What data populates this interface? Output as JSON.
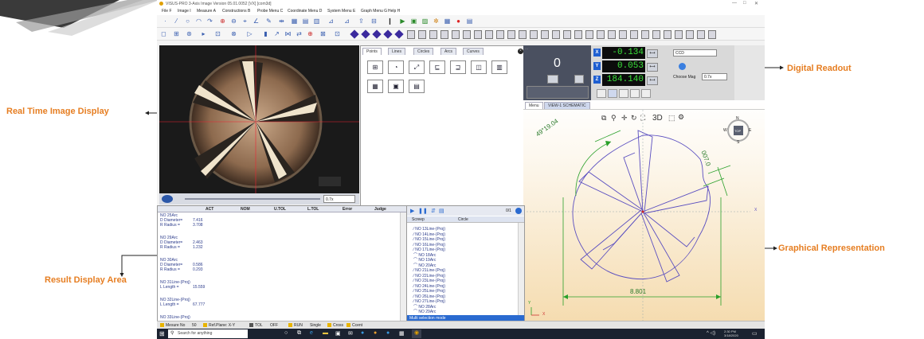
{
  "title_bar": {
    "text": "VISUS-PRO 3-Axis Image   Version 05.01.0052 [VX] [com3d]",
    "min": "—",
    "max": "□",
    "close": "✕"
  },
  "menu": [
    "File F",
    "Image I",
    "Measure A",
    "Constructions B",
    "Probe Menu C",
    "Coordinate Menu D",
    "System Menu E",
    "Graph Menu G",
    "Help H"
  ],
  "callouts": {
    "real_time": "Real Time Image Display",
    "digital_readout": "Digital Readout",
    "result_area": "Result Display Area",
    "graphical": "Graphical Representation"
  },
  "camera": {
    "zoom_select": "0.7x"
  },
  "tools_tabs": [
    "Points",
    "Lines",
    "Circles",
    "Arcs",
    "Curves"
  ],
  "readout": {
    "main_value": "0",
    "x_label": "X",
    "x_value": "-0.134",
    "y_label": "Y",
    "y_value": "0.053",
    "z_label": "Z",
    "z_value": "184.140",
    "camera_select": "CCD",
    "choose_mag_label": "Choose Mag",
    "mag_value": "0.7x"
  },
  "graph": {
    "tabs": [
      "Menu",
      "VIEW-1 SCHEMATIC"
    ],
    "toolbar_3d": "3D",
    "angle_label": "49°19.04",
    "tilt_label": "007.0",
    "width_label": "8.801",
    "compass_n": "N",
    "compass_s": "S",
    "compass_e": "E",
    "compass_w": "W",
    "compass_center": "TOP",
    "axis_x": "X",
    "axis_y": "Y"
  },
  "results": {
    "columns": [
      "ACT",
      "NOM",
      "U.TOL",
      "L.TOL",
      "Error",
      "Judge"
    ],
    "rows": [
      {
        "name": "NO  25Arc",
        "lines": [
          [
            "D  Diameter=",
            "7.416"
          ],
          [
            "R Radius =",
            "3.708"
          ]
        ]
      },
      {
        "name": "NO  29Arc",
        "lines": [
          [
            "D  Diameter=",
            "2.463"
          ],
          [
            "R Radius =",
            "1.232"
          ]
        ]
      },
      {
        "name": "NO  30Arc",
        "lines": [
          [
            "D  Diameter=",
            "0.586"
          ],
          [
            "R Radius =",
            "0.293"
          ]
        ]
      },
      {
        "name": "NO  31Line-(Proj)",
        "lines": [
          [
            "L Length =",
            "15.559"
          ]
        ]
      },
      {
        "name": "NO  32Line-(Proj)",
        "lines": [
          [
            "L Length =",
            "67.777"
          ]
        ]
      },
      {
        "name": "NO  33Line-(Proj)",
        "lines": []
      }
    ]
  },
  "features": {
    "counter": "0/1",
    "header_a": "Screep",
    "header_b": "Circle",
    "items": [
      "NO  13Line-(Proj)",
      "NO  14Line-(Proj)",
      "NO  15Line-(Proj)",
      "NO  16Line-(Proj)",
      "NO  17Line-(Proj)",
      "NO  18Arc",
      "NO  19Arc",
      "NO  20Arc",
      "NO  21Line-(Proj)",
      "NO  22Line-(Proj)",
      "NO  23Line-(Proj)",
      "NO  24Line-(Proj)",
      "NO  25Line-(Proj)",
      "NO  26Line-(Proj)",
      "NO  27Line-(Proj)",
      "NO  28Arc",
      "NO  29Arc"
    ],
    "footer": "Multi selection mode"
  },
  "status": {
    "items": [
      "Mesure No",
      "50",
      "Ref.Plane: X-Y",
      "TOL",
      "OFF",
      "RUN",
      "Single",
      "Cross",
      "Ccent"
    ]
  },
  "taskbar": {
    "search_placeholder": "Search for anything",
    "time": "2:30 PM",
    "date": "3/18/2020"
  }
}
